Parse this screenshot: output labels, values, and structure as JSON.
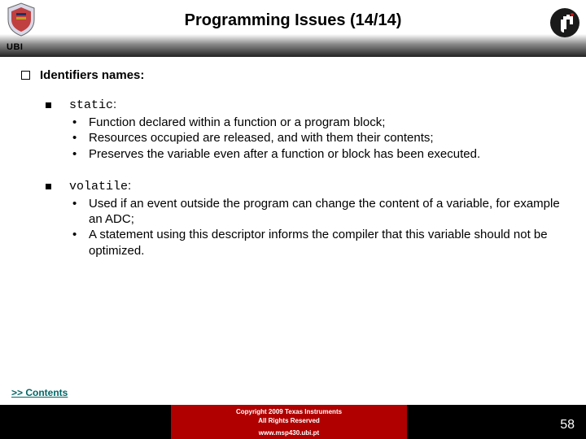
{
  "header": {
    "title": "Programming Issues (14/14)",
    "ubi_label": "UBI"
  },
  "heading": "Identifiers names:",
  "sections": [
    {
      "keyword": "static",
      "bullets": [
        "Function declared within a function or a program block;",
        "Resources occupied are released, and with them their contents;",
        "Preserves the variable even after a function or block has been executed."
      ]
    },
    {
      "keyword": "volatile",
      "bullets": [
        "Used if an event outside the program can change the content of a variable, for example an ADC;",
        "A statement using this descriptor informs the compiler that this variable should not be optimized."
      ]
    }
  ],
  "contents_link": ">> Contents",
  "footer": {
    "line1": "Copyright 2009 Texas Instruments",
    "line2": "All Rights Reserved",
    "line3": "www.msp430.ubi.pt"
  },
  "page_number": "58"
}
